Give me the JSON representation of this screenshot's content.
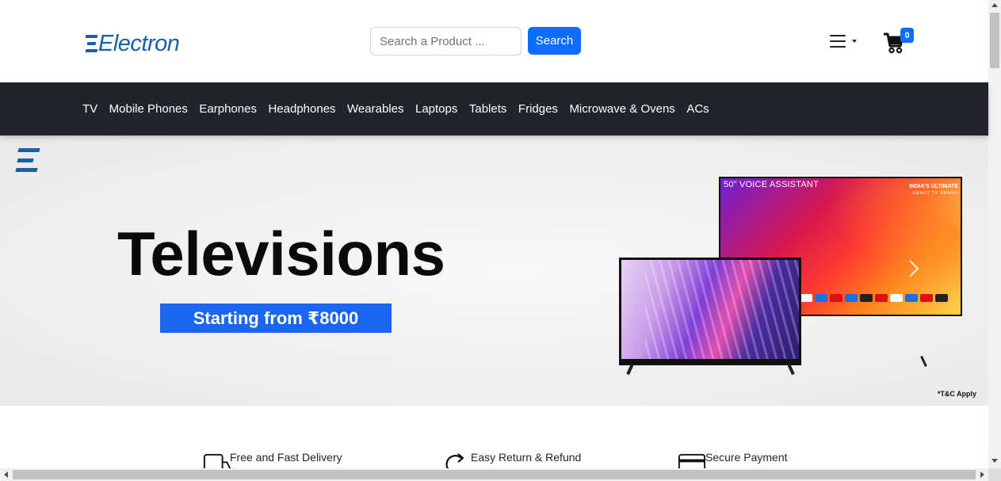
{
  "brand": {
    "name": "Electron",
    "color": "#1b5fa8"
  },
  "search": {
    "placeholder": "Search a Product ...",
    "value": "",
    "button_label": "Search"
  },
  "header": {
    "menu_icon": "hamburger-icon",
    "cart_icon": "cart-icon",
    "cart_count": "0"
  },
  "nav": {
    "items": [
      {
        "label": "TV"
      },
      {
        "label": "Mobile Phones"
      },
      {
        "label": "Earphones"
      },
      {
        "label": "Headphones"
      },
      {
        "label": "Wearables"
      },
      {
        "label": "Laptops"
      },
      {
        "label": "Tablets"
      },
      {
        "label": "Fridges"
      },
      {
        "label": "Microwave & Ovens"
      },
      {
        "label": "ACs"
      }
    ]
  },
  "banner": {
    "title": "Televisions",
    "cta": "Starting from ₹8000",
    "tv_label": "50\" VOICE ASSISTANT",
    "tv_tag_line1": "INDIA'S ULTIMATE",
    "tv_tag_line2": "SMART TV BRAND",
    "note": "*T&C Apply"
  },
  "features": [
    {
      "label": "Free and Fast Delivery",
      "icon": "delivery-truck-icon"
    },
    {
      "label": "Easy Return & Refund",
      "icon": "return-arrow-icon"
    },
    {
      "label": "Secure Payment",
      "icon": "credit-card-icon"
    }
  ],
  "colors": {
    "primary": "#0d6efd",
    "navbar": "#212529",
    "cta": "#1a66f0"
  }
}
